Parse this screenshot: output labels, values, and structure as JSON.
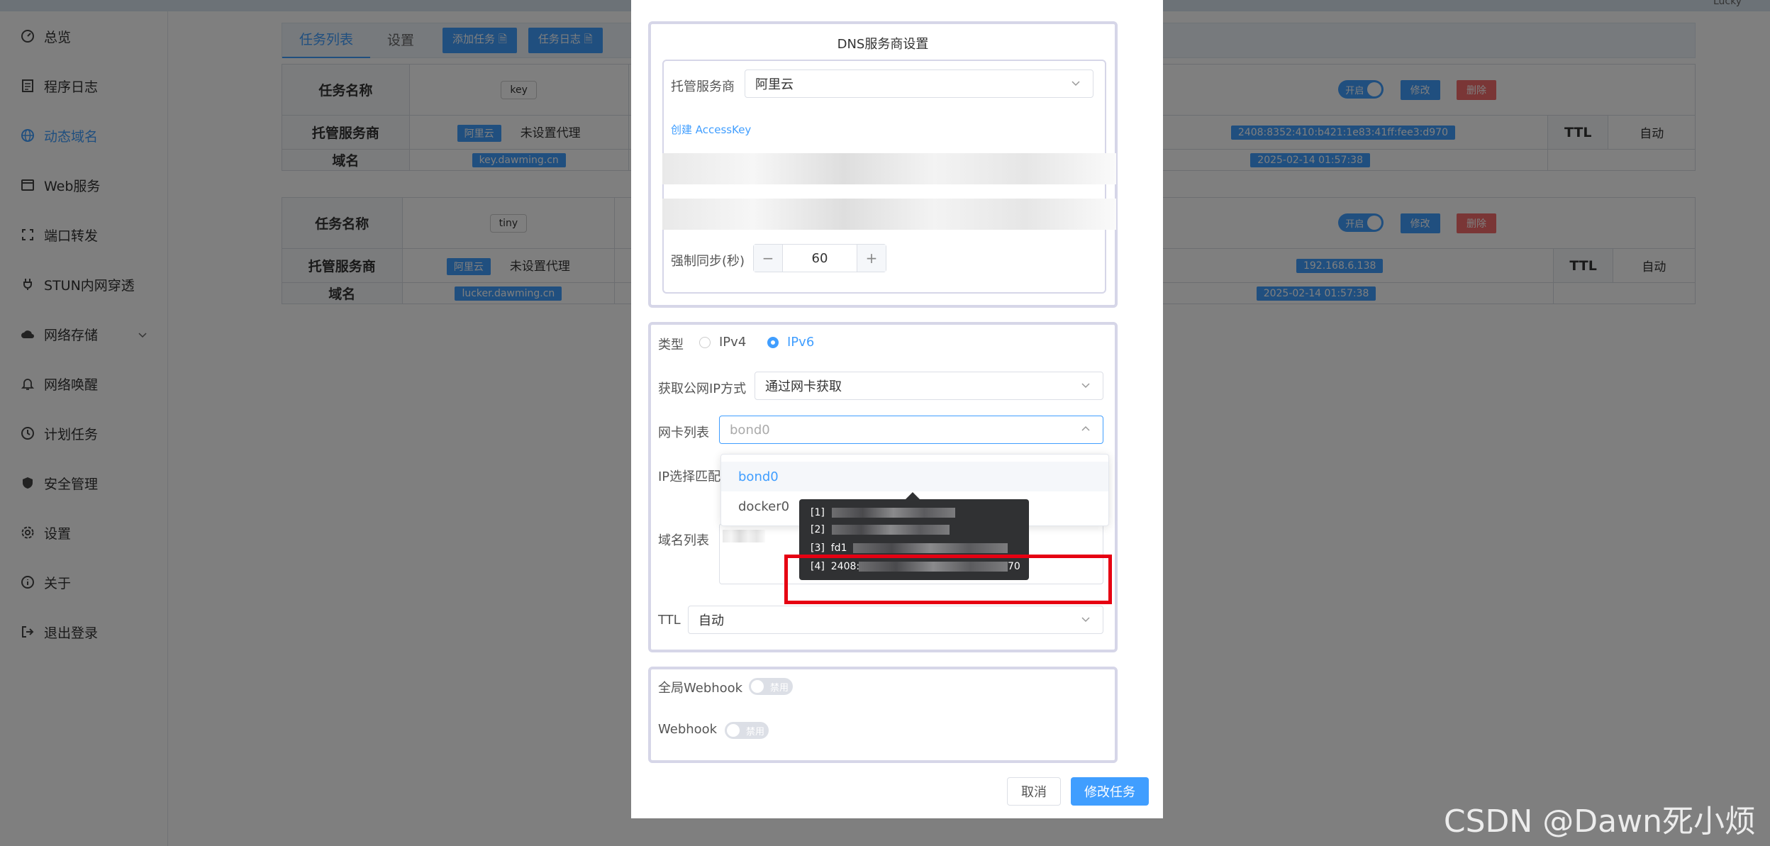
{
  "topbar": {
    "user": "Lucky"
  },
  "sidebar": {
    "items": [
      {
        "label": "总览"
      },
      {
        "label": "程序日志"
      },
      {
        "label": "动态域名"
      },
      {
        "label": "Web服务"
      },
      {
        "label": "端口转发"
      },
      {
        "label": "STUN内网穿透"
      },
      {
        "label": "网络存储"
      },
      {
        "label": "网络唤醒"
      },
      {
        "label": "计划任务"
      },
      {
        "label": "安全管理"
      },
      {
        "label": "设置"
      },
      {
        "label": "关于"
      },
      {
        "label": "退出登录"
      }
    ]
  },
  "tabs": {
    "task_list": "任务列表",
    "settings": "设置",
    "add_task": "添加任务",
    "task_log": "任务日志"
  },
  "tasks": [
    {
      "name_label": "任务名称",
      "name": "key",
      "provider_label": "托管服务商",
      "provider": "阿里云",
      "proxy": "未设置代理",
      "domain_label": "域名",
      "domain": "key.dawming.cn",
      "switch": "开启",
      "edit": "修改",
      "delete": "删除",
      "ip": "2408:8352:410:b421:1e83:41ff:fee3:d970",
      "ttl_label": "TTL",
      "ttl": "自动",
      "time": "2025-02-14 01:57:38"
    },
    {
      "name_label": "任务名称",
      "name": "tiny",
      "provider_label": "托管服务商",
      "provider": "阿里云",
      "proxy": "未设置代理",
      "domain_label": "域名",
      "domain": "lucker.dawming.cn",
      "switch": "开启",
      "edit": "修改",
      "delete": "删除",
      "ip": "192.168.6.138",
      "ttl_label": "TTL",
      "ttl": "自动",
      "time": "2025-02-14 01:57:38"
    }
  ],
  "modal": {
    "dns_title": "DNS服务商设置",
    "provider_label": "托管服务商",
    "provider_value": "阿里云",
    "create_key_link": "创建 AccessKey",
    "sync_label": "强制同步(秒)",
    "sync_minus": "−",
    "sync_value": "60",
    "sync_plus": "+",
    "type_label": "类型",
    "ipv4": "IPv4",
    "ipv6": "IPv6",
    "ip_method_label": "获取公网IP方式",
    "ip_method_value": "通过网卡获取",
    "nic_label": "网卡列表",
    "nic_value": "bond0",
    "ip_match_label": "IP选择匹配",
    "domain_list_label": "域名列表",
    "ttl_label": "TTL",
    "ttl_value": "自动",
    "dropdown": [
      "bond0",
      "docker0"
    ],
    "tooltip": {
      "lines": [
        {
          "idx": "[1]",
          "text": ""
        },
        {
          "idx": "[2]",
          "text": ""
        },
        {
          "idx": "[3]",
          "text": "fd1"
        },
        {
          "idx": "[4]",
          "text": "2408:",
          "tail": "70"
        }
      ]
    },
    "global_webhook_label": "全局Webhook",
    "global_webhook_state": "禁用",
    "webhook_label": "Webhook",
    "webhook_state": "禁用",
    "cancel": "取消",
    "submit": "修改任务"
  },
  "watermark": "CSDN @Dawn死小烦"
}
